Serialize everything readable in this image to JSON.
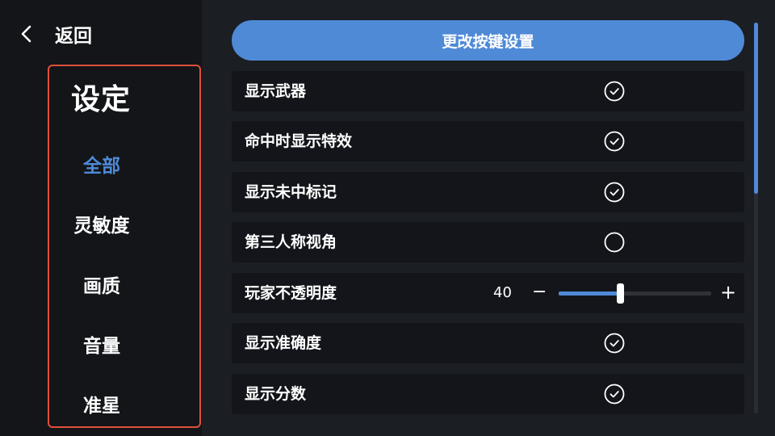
{
  "nav": {
    "back_label": "返回",
    "back_icon": "chevron-left-icon"
  },
  "menu": {
    "title": "设定",
    "items": [
      {
        "label": "全部",
        "active": true
      },
      {
        "label": "灵敏度",
        "active": false
      },
      {
        "label": "画质",
        "active": false
      },
      {
        "label": "音量",
        "active": false
      },
      {
        "label": "准星",
        "active": false
      }
    ],
    "border_color": "#e0503a",
    "active_color": "#4e8ad8"
  },
  "settings": {
    "change_keys_label": "更改按键设置",
    "rows": [
      {
        "label": "显示武器",
        "type": "checkbox",
        "checked": true
      },
      {
        "label": "命中时显示特效",
        "type": "checkbox",
        "checked": true
      },
      {
        "label": "显示未中标记",
        "type": "checkbox",
        "checked": true
      },
      {
        "label": "第三人称视角",
        "type": "checkbox",
        "checked": false
      },
      {
        "label": "玩家不透明度",
        "type": "slider",
        "value": "40",
        "minus": "−",
        "plus": "+",
        "fill_fraction": 0.4
      },
      {
        "label": "显示准确度",
        "type": "checkbox",
        "checked": true
      },
      {
        "label": "显示分数",
        "type": "checkbox",
        "checked": true
      }
    ],
    "accent_color": "#4f8ad7"
  }
}
